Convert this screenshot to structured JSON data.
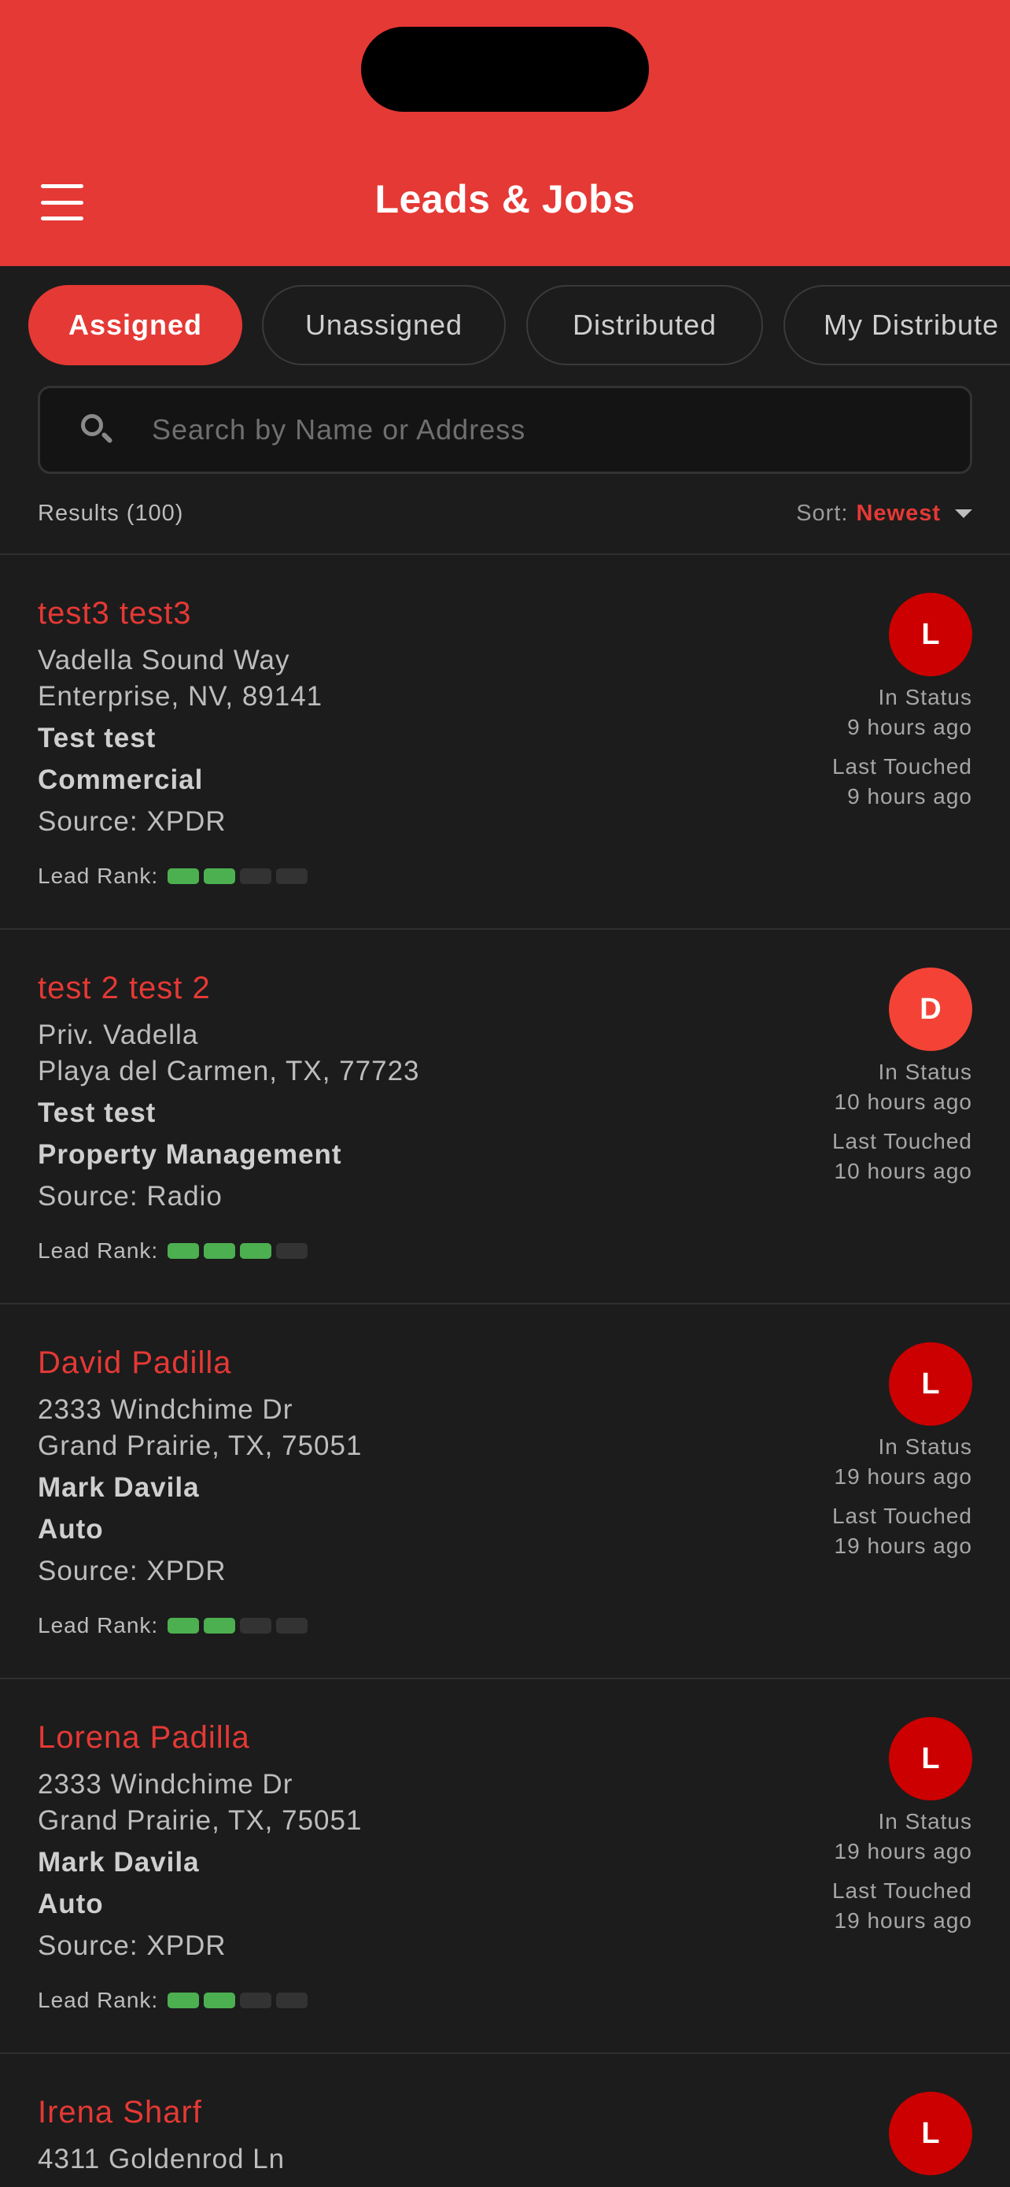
{
  "header": {
    "title": "Leads & Jobs"
  },
  "tabs": [
    {
      "label": "Assigned",
      "active": true
    },
    {
      "label": "Unassigned",
      "active": false
    },
    {
      "label": "Distributed",
      "active": false
    },
    {
      "label": "My Distribute",
      "active": false
    }
  ],
  "search": {
    "placeholder": "Search by Name or Address",
    "value": ""
  },
  "results": {
    "label": "Results (100)"
  },
  "sort": {
    "label": "Sort:",
    "value": "Newest"
  },
  "cards": [
    {
      "name": "test3 test3",
      "address1": "Vadella Sound Way",
      "address2": "Enterprise, NV, 89141",
      "contact": "Test test",
      "type": "Commercial",
      "source": "Source: XPDR",
      "rank_label": "Lead Rank:",
      "rank": 2,
      "rank_max": 4,
      "avatar": "L",
      "in_status_label": "In Status",
      "in_status": "9 hours ago",
      "last_touched_label": "Last Touched",
      "last_touched": "9 hours ago"
    },
    {
      "name": "test 2 test 2",
      "address1": "Priv. Vadella",
      "address2": "Playa del Carmen, TX, 77723",
      "contact": "Test test",
      "type": "Property Management",
      "source": "Source: Radio",
      "rank_label": "Lead Rank:",
      "rank": 3,
      "rank_max": 4,
      "avatar": "D",
      "in_status_label": "In Status",
      "in_status": "10 hours ago",
      "last_touched_label": "Last Touched",
      "last_touched": "10 hours ago"
    },
    {
      "name": "David Padilla",
      "address1": "2333 Windchime Dr",
      "address2": "Grand Prairie, TX, 75051",
      "contact": "Mark Davila",
      "type": "Auto",
      "source": "Source: XPDR",
      "rank_label": "Lead Rank:",
      "rank": 2,
      "rank_max": 4,
      "avatar": "L",
      "in_status_label": "In Status",
      "in_status": "19 hours ago",
      "last_touched_label": "Last Touched",
      "last_touched": "19 hours ago"
    },
    {
      "name": "Lorena Padilla",
      "address1": "2333 Windchime Dr",
      "address2": "Grand Prairie, TX, 75051",
      "contact": "Mark Davila",
      "type": "Auto",
      "source": "Source: XPDR",
      "rank_label": "Lead Rank:",
      "rank": 2,
      "rank_max": 4,
      "avatar": "L",
      "in_status_label": "In Status",
      "in_status": "19 hours ago",
      "last_touched_label": "Last Touched",
      "last_touched": "19 hours ago"
    },
    {
      "name": "Irena Sharf",
      "address1": "4311 Goldenrod Ln",
      "avatar": "L"
    }
  ],
  "colors": {
    "accent": "#e53935",
    "background": "#1c1c1c",
    "rank_on": "#4caf50",
    "rank_off": "#333333",
    "avatar_dark": "#cc0000",
    "avatar_light": "#f44336"
  }
}
